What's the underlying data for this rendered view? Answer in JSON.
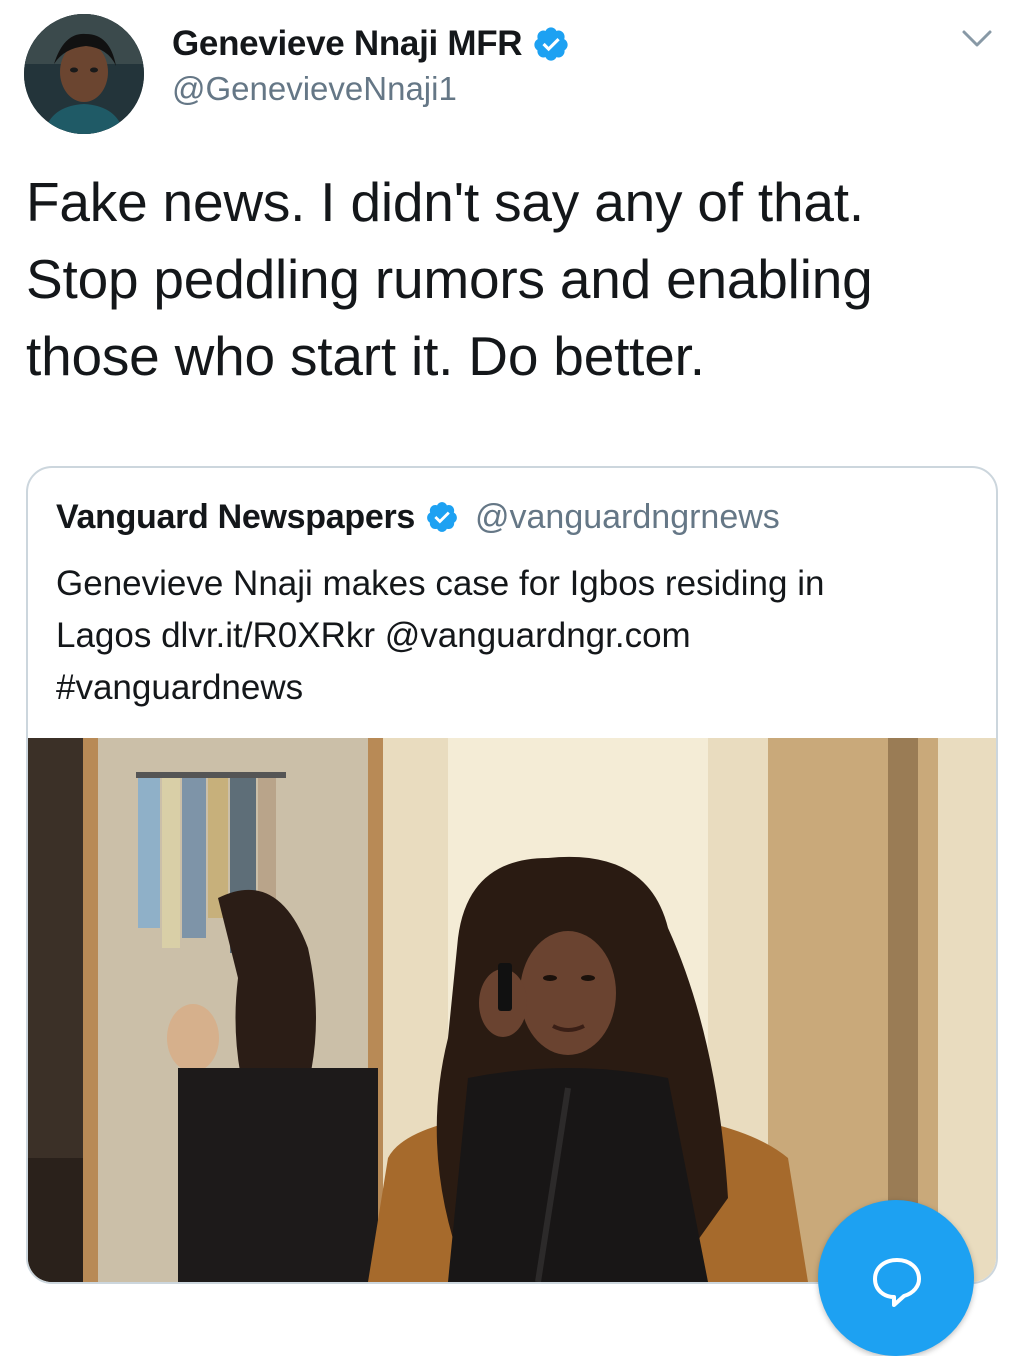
{
  "tweet": {
    "author": {
      "display_name": "Genevieve Nnaji MFR",
      "handle": "@GenevieveNnaji1",
      "verified": true,
      "avatar_icon": "profile-photo"
    },
    "menu_icon": "chevron-down-icon",
    "text": "Fake news. I didn't say any of that.\nStop peddling rumors and enabling\nthose who start it. Do better."
  },
  "quoted_tweet": {
    "author": {
      "display_name": "Vanguard Newspapers",
      "handle": "@vanguardngrnews",
      "verified": true
    },
    "text": "Genevieve Nnaji makes case for Igbos residing in\nLagos dlvr.it/R0XRkr @vanguardngr.com\n#vanguardnews",
    "media_icon": "photo"
  },
  "compose_button": {
    "icon": "speech-bubble-icon"
  },
  "colors": {
    "accent": "#1da1f2",
    "text_primary": "#14171a",
    "text_secondary": "#657786",
    "border": "#ccd6dd"
  }
}
